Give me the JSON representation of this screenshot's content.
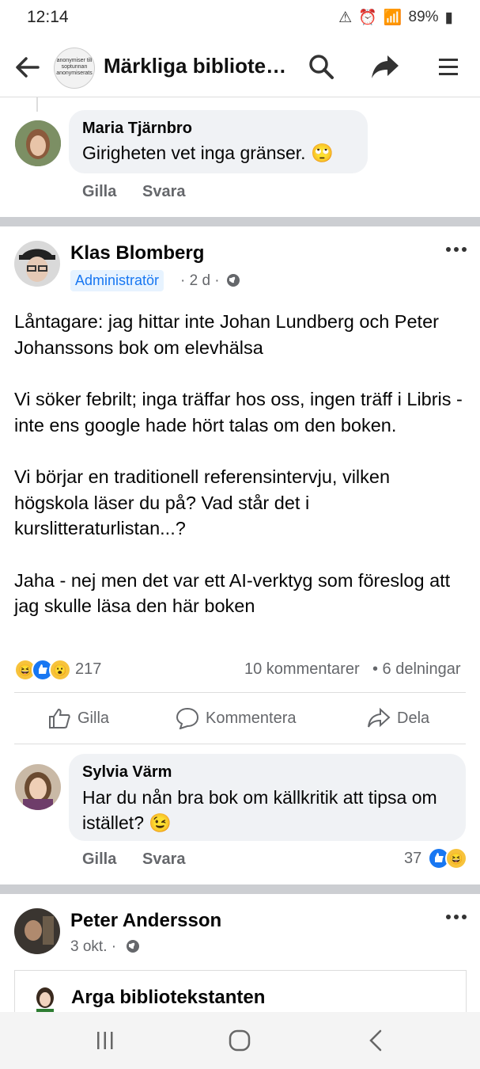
{
  "status_bar": {
    "time": "12:14",
    "battery": "89%"
  },
  "app_bar": {
    "title": "Märkliga bibliote…",
    "group_logo_text": "anonymiser till soptunnan anonymiserats"
  },
  "comment_top": {
    "author": "Maria Tjärnbro",
    "text": "Girigheten vet inga gränser. 🙄",
    "like_label": "Gilla",
    "reply_label": "Svara"
  },
  "post": {
    "author": "Klas Blomberg",
    "badge": "Administratör",
    "meta": "· 2 d ·",
    "paragraphs": [
      "Låntagare: jag hittar inte Johan Lundberg och Peter Johanssons bok om elevhälsa",
      "Vi söker febrilt; inga träffar hos oss, ingen träff i Libris - inte ens google hade hört talas om den boken.",
      "Vi börjar en traditionell referensintervju, vilken högskola läser du på? Vad står det i kurslitteraturlistan...?",
      "Jaha - nej men det var ett AI-verktyg som föreslog att jag skulle läsa den här boken"
    ],
    "reaction_count": "217",
    "comments_count": "10 kommentarer",
    "shares_count": "• 6 delningar",
    "buttons": {
      "like": "Gilla",
      "comment": "Kommentera",
      "share": "Dela"
    }
  },
  "comment_second": {
    "author": "Sylvia Värm",
    "text": "Har du nån bra bok om källkritik att tipsa om istället? 😉",
    "like_label": "Gilla",
    "reply_label": "Svara",
    "reaction_count": "37"
  },
  "post_next": {
    "author": "Peter Andersson",
    "meta": "3 okt. ·",
    "shared_author": "Arga bibliotekstanten"
  },
  "colors": {
    "accent": "#1877f2",
    "secondary_text": "#65676b",
    "bubble": "#f0f2f5"
  }
}
